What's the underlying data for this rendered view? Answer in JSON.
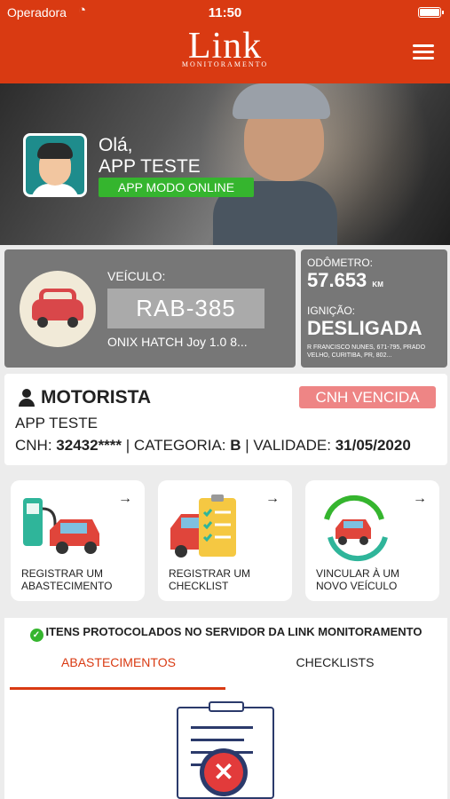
{
  "status": {
    "carrier": "Operadora",
    "time": "11:50"
  },
  "header": {
    "logo": "Link",
    "logo_sub": "MONITORAMENTO"
  },
  "profile": {
    "greeting": "Olá,",
    "name": "APP TESTE",
    "mode": "APP MODO ONLINE"
  },
  "vehicle": {
    "label": "VEÍCULO:",
    "plate": "RAB-385",
    "model": "ONIX HATCH Joy 1.0 8..."
  },
  "odometer": {
    "label": "ODÔMETRO:",
    "value": "57.653",
    "unit": "KM",
    "ignition_label": "IGNIÇÃO:",
    "ignition_value": "DESLIGADA",
    "address": "R FRANCISCO NUNES, 671-795, PRADO VELHO, CURITIBA, PR, 802..."
  },
  "driver": {
    "title": "MOTORISTA",
    "badge": "CNH VENCIDA",
    "name": "APP TESTE",
    "cnh_label": "CNH:",
    "cnh_value": "32432****",
    "category_label": "CATEGORIA:",
    "category_value": "B",
    "validity_label": "VALIDADE:",
    "validity_value": "31/05/2020"
  },
  "actions": [
    {
      "label": "REGISTRAR UM ABASTECIMENTO"
    },
    {
      "label": "REGISTRAR UM CHECKLIST"
    },
    {
      "label": "VINCULAR À UM NOVO VEÍCULO"
    }
  ],
  "protocol": {
    "header": "ITENS PROTOCOLADOS NO SERVIDOR DA LINK MONITORAMENTO",
    "tabs": [
      "ABASTECIMENTOS",
      "CHECKLISTS"
    ],
    "active_tab": "ABASTECIMENTOS"
  },
  "colors": {
    "brand": "#d93a12",
    "online": "#35b52e",
    "warning": "#ee8585",
    "card": "#777777"
  }
}
